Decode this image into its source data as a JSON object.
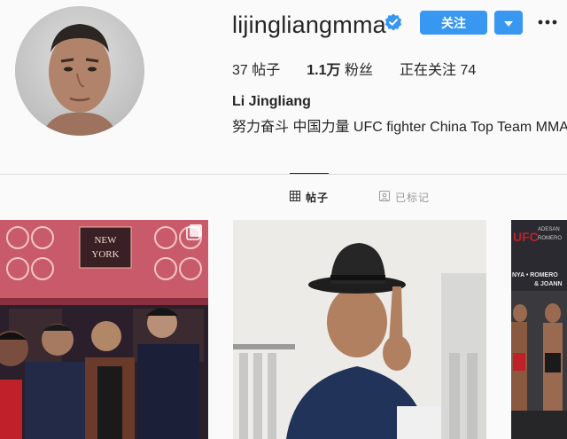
{
  "profile": {
    "username": "lijingliangmma",
    "verified_icon": "verified-badge-icon",
    "follow_label": "关注",
    "stats": {
      "posts_count": "37",
      "posts_label": "帖子",
      "followers_count": "1.1万",
      "followers_label": "粉丝",
      "following_label": "正在关注",
      "following_count": "74"
    },
    "full_name": "Li Jingliang",
    "bio": "努力奋斗 中国力量 UFC fighter China Top Team MMA"
  },
  "tabs": [
    {
      "label": "帖子",
      "icon": "grid-icon",
      "active": true
    },
    {
      "label": "已标记",
      "icon": "tag-icon",
      "active": false
    }
  ],
  "posts": [
    {
      "sign_text": "NEW YORK"
    },
    {},
    {
      "banner_lines": [
        "ADESAN",
        "ROMERO",
        "NYA • ROMERO",
        "& JOANN"
      ]
    }
  ],
  "colors": {
    "accent": "#3897f0",
    "background": "#fafafa",
    "divider": "#dbdbdb"
  }
}
